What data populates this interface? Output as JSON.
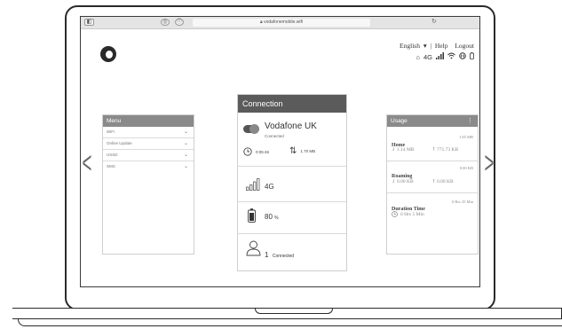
{
  "browser": {
    "url": "vodafonemobile.wifi"
  },
  "header": {
    "language": "English",
    "language_caret": "▾",
    "help": "Help",
    "logout": "Logout",
    "network_label": "4G"
  },
  "menu": {
    "title": "Menu",
    "items": [
      {
        "label": "WiFi"
      },
      {
        "label": "Online Update"
      },
      {
        "label": "USSD"
      },
      {
        "label": "SMS"
      }
    ]
  },
  "connection": {
    "title": "Connection",
    "provider": "Vodafone UK",
    "status": "Connected",
    "duration": "0:05:46",
    "data_used": "1.70 MB",
    "network": "4G",
    "battery_value": "80",
    "battery_unit": "%",
    "clients_count": "1",
    "clients_label": "Connected"
  },
  "usage": {
    "title": "Usage",
    "home_label": "Home",
    "home_total": "1.85 MB",
    "home_down": "1.14 MB",
    "home_up": "771.73 KB",
    "roaming_label": "Roaming",
    "roaming_total": "0.00 KB",
    "roaming_down": "0.00 KB",
    "roaming_up": "0.00 KB",
    "duration_label": "Duration Time",
    "duration_total": "0 Hrs 35 Min",
    "duration_value": "0 Hrs 5 Min"
  }
}
